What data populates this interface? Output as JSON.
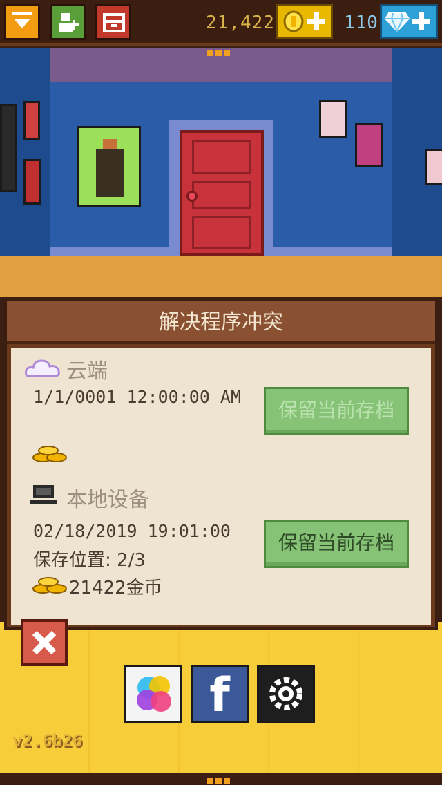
{
  "topbar": {
    "coins": "21,422",
    "gems": "110",
    "colors": {
      "bar": "#3b1e10",
      "coin_button": "#e8b800",
      "gem_button": "#2da0d8"
    }
  },
  "dialog": {
    "title": "解决程序冲突",
    "cloud": {
      "label": "云端",
      "datetime": "1/1/0001 12:00:00 AM",
      "keep_label": "保留当前存档"
    },
    "local": {
      "label": "本地设备",
      "datetime": "02/18/2019 19:01:00",
      "slot": "保存位置: 2/3",
      "coins": "21422金币",
      "keep_label": "保留当前存档"
    }
  },
  "bottom": {
    "facebook_letter": "f",
    "version": "v2.6b26"
  },
  "icons": [
    "dropdown-arrow-icon",
    "add-friend-icon",
    "storage-icon",
    "coin-icon",
    "diamond-icon",
    "cloud-icon",
    "computer-icon",
    "coins-stack-icon",
    "close-x-icon",
    "game-center-icon",
    "facebook-icon",
    "gear-icon"
  ]
}
